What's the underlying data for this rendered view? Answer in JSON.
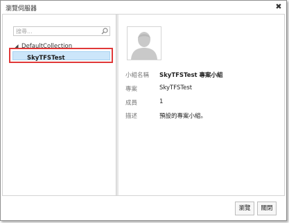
{
  "window": {
    "title": "瀏覽伺服器",
    "close_glyph": "✖"
  },
  "search": {
    "placeholder": "搜尋..."
  },
  "tree": {
    "root": {
      "label": "DefaultCollection",
      "expanded": true
    },
    "selected_item": {
      "label": "SkyTFSTest"
    }
  },
  "details": {
    "rows": [
      {
        "label": "小組名稱",
        "value": "SkyTFSTest 專案小組"
      },
      {
        "label": "專案",
        "value": "SkyTFSTest"
      },
      {
        "label": "成員",
        "value": "1"
      },
      {
        "label": "描述",
        "value": "預設的專案小組。"
      }
    ]
  },
  "buttons": {
    "browse": "瀏覽",
    "close": "關閉"
  },
  "colors": {
    "selection_fill": "#cce6fa",
    "highlight_border": "#e03838",
    "splitter": "#e6e6e6"
  },
  "icons": {
    "search": "search-icon",
    "expander": "expand-triangle-icon",
    "avatar": "user-silhouette-icon",
    "close": "close-icon"
  }
}
